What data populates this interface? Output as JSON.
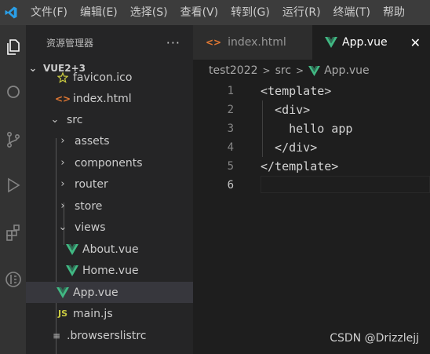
{
  "menubar": {
    "items": [
      "文件(F)",
      "编辑(E)",
      "选择(S)",
      "查看(V)",
      "转到(G)",
      "运行(R)",
      "终端(T)",
      "帮助"
    ]
  },
  "activity_bar": {
    "icons": [
      "explorer-icon",
      "search-icon",
      "source-control-icon",
      "run-debug-icon",
      "extensions-icon",
      "database-icon"
    ]
  },
  "explorer": {
    "title": "资源管理器",
    "more": "···",
    "section": "VUE2+3",
    "rows": [
      {
        "label": "favicon.ico",
        "icon": "favicon-icon"
      },
      {
        "label": "index.html",
        "icon": "html-file-icon"
      },
      {
        "label": "src",
        "icon": "folder-expanded"
      },
      {
        "label": "assets",
        "icon": "folder-collapsed"
      },
      {
        "label": "components",
        "icon": "folder-collapsed"
      },
      {
        "label": "router",
        "icon": "folder-collapsed"
      },
      {
        "label": "store",
        "icon": "folder-collapsed"
      },
      {
        "label": "views",
        "icon": "folder-expanded"
      },
      {
        "label": "About.vue",
        "icon": "vue-file-icon"
      },
      {
        "label": "Home.vue",
        "icon": "vue-file-icon"
      },
      {
        "label": "App.vue",
        "icon": "vue-file-icon",
        "selected": true
      },
      {
        "label": "main.js",
        "icon": "js-file-icon"
      },
      {
        "label": ".browserslistrc",
        "icon": "config-file-icon"
      }
    ]
  },
  "tabs": [
    {
      "label": "index.html",
      "icon": "html-file-icon",
      "active": false
    },
    {
      "label": "App.vue",
      "icon": "vue-file-icon",
      "active": true
    }
  ],
  "breadcrumb": {
    "parts": [
      "test2022",
      "src",
      "App.vue"
    ]
  },
  "editor": {
    "lines": [
      {
        "num": "1",
        "text": "<template>"
      },
      {
        "num": "2",
        "text": "  <div>"
      },
      {
        "num": "3",
        "text": "    hello app"
      },
      {
        "num": "4",
        "text": "  </div>"
      },
      {
        "num": "5",
        "text": "</template>"
      },
      {
        "num": "6",
        "text": ""
      }
    ],
    "current_line": "6"
  },
  "watermark": "CSDN @Drizzlejj",
  "colors": {
    "vue_green": "#41b883",
    "html_orange": "#e37933",
    "js_yellow": "#cbcb41",
    "selected_row": "#37373d"
  }
}
